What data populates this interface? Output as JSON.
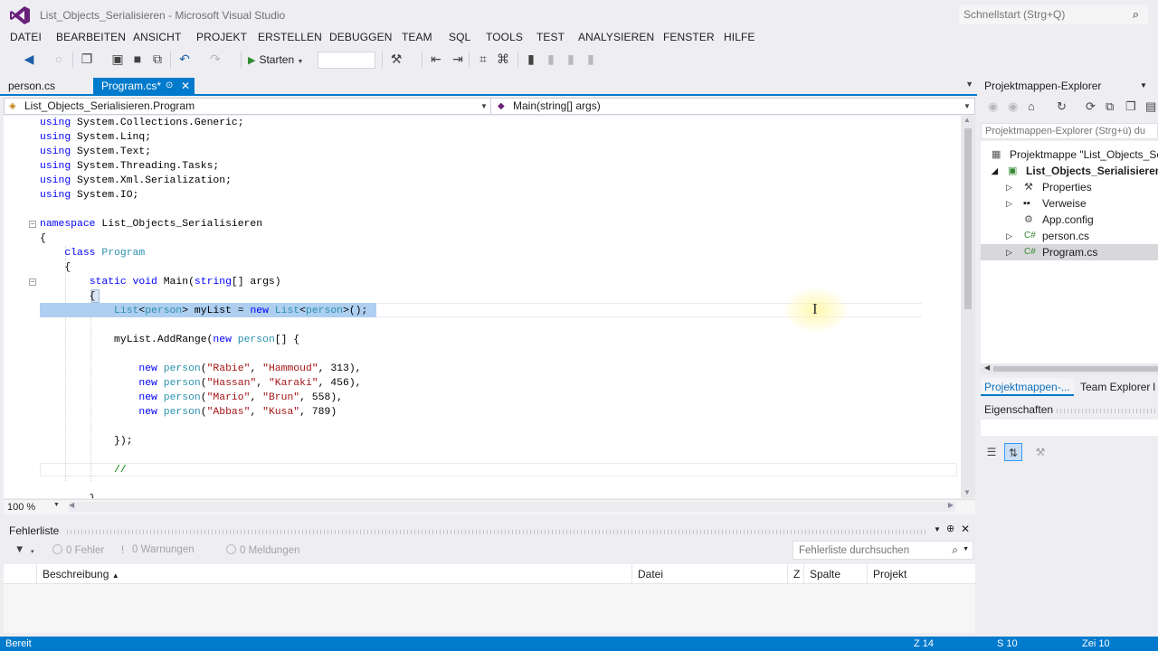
{
  "window": {
    "title": "List_Objects_Serialisieren - Microsoft Visual Studio",
    "quick_launch_placeholder": "Schnellstart (Strg+Q)"
  },
  "menu": [
    "DATEI",
    "BEARBEITEN",
    "ANSICHT",
    "PROJEKT",
    "ERSTELLEN",
    "DEBUGGEN",
    "TEAM",
    "SQL",
    "TOOLS",
    "TEST",
    "ANALYSIEREN",
    "FENSTER",
    "HILFE"
  ],
  "toolbar": {
    "start_label": "Starten"
  },
  "tabs": [
    {
      "label": "person.cs"
    },
    {
      "label": "Program.cs*"
    }
  ],
  "navbar": {
    "type_dropdown": "List_Objects_Serialisieren.Program",
    "member_dropdown": "Main(string[] args)"
  },
  "editor": {
    "zoom": "100 %"
  },
  "error_list": {
    "title": "Fehlerliste",
    "errors_label": "0 Fehler",
    "warnings_label": "0 Warnungen",
    "messages_label": "0 Meldungen",
    "search_placeholder": "Fehlerliste durchsuchen",
    "columns": [
      "Beschreibung",
      "Datei",
      "Z",
      "Spalte",
      "Projekt"
    ]
  },
  "solution_explorer": {
    "title": "Projektmappen-Explorer",
    "search_placeholder": "Projektmappen-Explorer (Strg+ü) du",
    "tree": [
      {
        "label": "Projektmappe \"List_Objects_Se",
        "icon": "solution-icon"
      },
      {
        "label": "List_Objects_Serialisieren",
        "icon": "csharp-project-icon"
      },
      {
        "label": "Properties",
        "icon": "wrench-icon"
      },
      {
        "label": "Verweise",
        "icon": "references-icon"
      },
      {
        "label": "App.config",
        "icon": "config-file-icon"
      },
      {
        "label": "person.cs",
        "icon": "csharp-file-icon"
      },
      {
        "label": "Program.cs",
        "icon": "csharp-file-icon"
      }
    ],
    "tabs": [
      "Projektmappen-...",
      "Team Explorer",
      "I"
    ]
  },
  "properties": {
    "title": "Eigenschaften"
  },
  "status": {
    "text": "Bereit",
    "line": "Z 14",
    "col": "S 10",
    "char": "Zei 10"
  },
  "colors": {
    "accent": "#007acc",
    "keyword": "#0000ff",
    "type": "#2b91af",
    "string": "#a31515",
    "selection": "#aecff0"
  }
}
